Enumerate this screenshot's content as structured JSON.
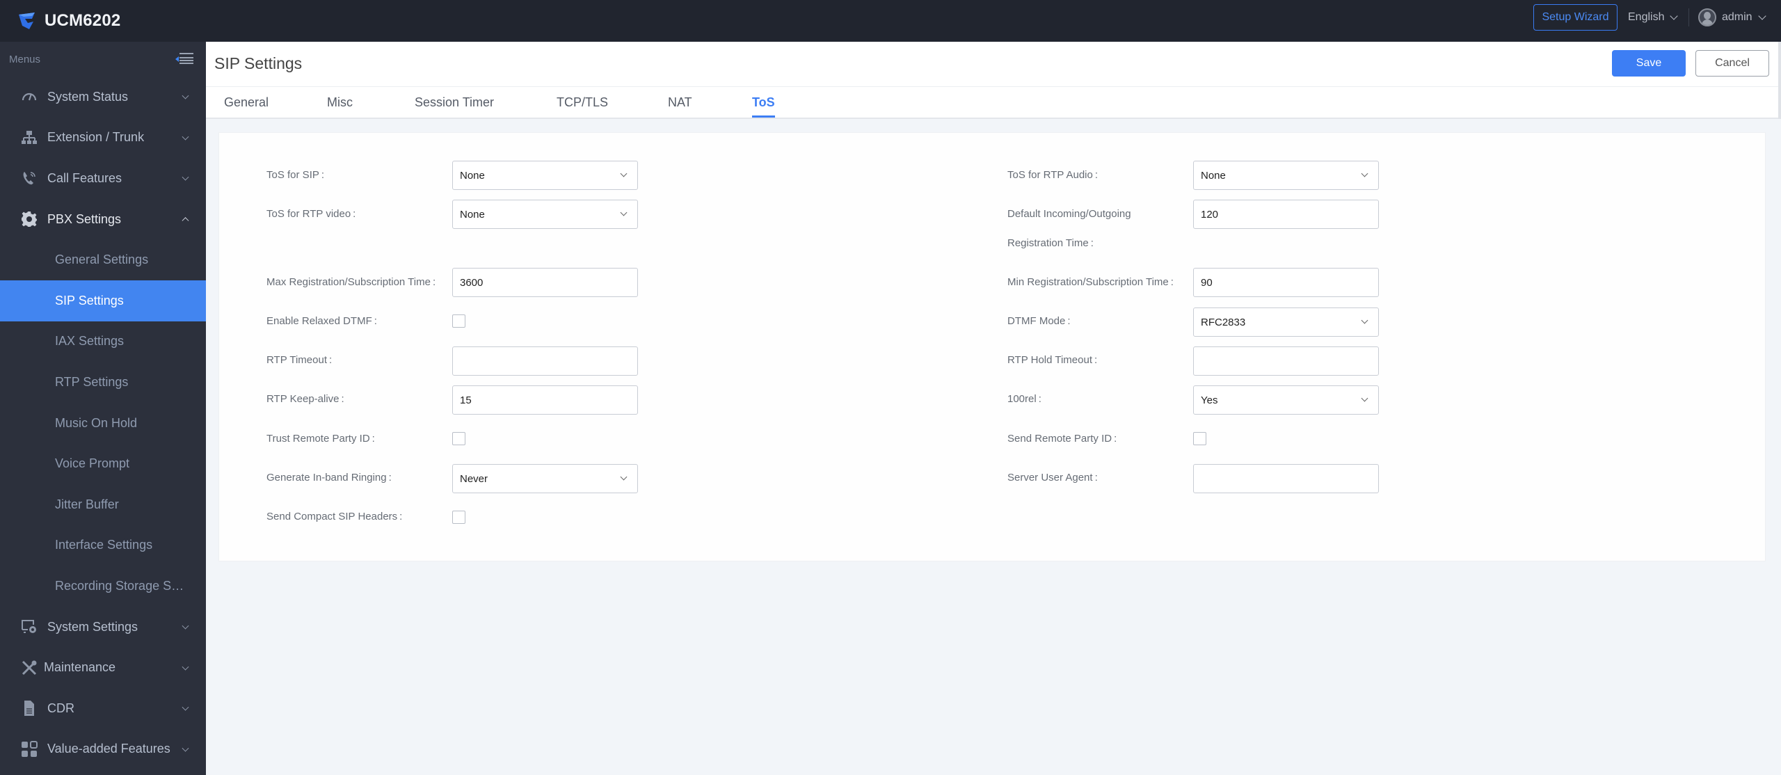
{
  "header": {
    "app_name": "UCM6202",
    "setup_wizard": "Setup Wizard",
    "language": "English",
    "user": "admin"
  },
  "sidebar": {
    "menus_label": "Menus",
    "items": [
      {
        "label": "System Status",
        "icon": "gauge-icon"
      },
      {
        "label": "Extension / Trunk",
        "icon": "network-icon"
      },
      {
        "label": "Call Features",
        "icon": "phone-call-icon"
      },
      {
        "label": "PBX Settings",
        "icon": "gear-icon",
        "expanded": true
      }
    ],
    "sub_items": [
      {
        "label": "General Settings"
      },
      {
        "label": "SIP Settings",
        "active": true
      },
      {
        "label": "IAX Settings"
      },
      {
        "label": "RTP Settings"
      },
      {
        "label": "Music On Hold"
      },
      {
        "label": "Voice Prompt"
      },
      {
        "label": "Jitter Buffer"
      },
      {
        "label": "Interface Settings"
      },
      {
        "label": "Recording Storage Se..."
      }
    ],
    "bottom_items": [
      {
        "label": "System Settings",
        "icon": "monitor-gear-icon"
      },
      {
        "label": "Maintenance",
        "icon": "tools-icon"
      },
      {
        "label": "CDR",
        "icon": "document-icon"
      },
      {
        "label": "Value-added Features",
        "icon": "apps-grid-icon"
      }
    ]
  },
  "page": {
    "title": "SIP Settings",
    "save": "Save",
    "cancel": "Cancel",
    "tabs": [
      "General",
      "Misc",
      "Session Timer",
      "TCP/TLS",
      "NAT",
      "ToS"
    ],
    "active_tab": "ToS"
  },
  "form": {
    "tos_sip": {
      "label": "ToS for SIP",
      "value": "None"
    },
    "tos_rtp_audio": {
      "label": "ToS for RTP Audio",
      "value": "None"
    },
    "tos_rtp_video": {
      "label": "ToS for RTP video",
      "value": "None"
    },
    "default_reg_time": {
      "label_line1": "Default Incoming/Outgoing",
      "label_line2": "Registration Time",
      "value": "120"
    },
    "max_reg_time": {
      "label": "Max Registration/Subscription Time",
      "value": "3600"
    },
    "min_reg_time": {
      "label": "Min Registration/Subscription Time",
      "value": "90"
    },
    "relaxed_dtmf": {
      "label": "Enable Relaxed DTMF",
      "checked": false
    },
    "dtmf_mode": {
      "label": "DTMF Mode",
      "value": "RFC2833"
    },
    "rtp_timeout": {
      "label": "RTP Timeout",
      "value": ""
    },
    "rtp_hold_timeout": {
      "label": "RTP Hold Timeout",
      "value": ""
    },
    "rtp_keepalive": {
      "label": "RTP Keep-alive",
      "value": "15"
    },
    "rel100": {
      "label": "100rel",
      "value": "Yes"
    },
    "trust_rpid": {
      "label": "Trust Remote Party ID",
      "checked": false
    },
    "send_rpid": {
      "label": "Send Remote Party ID",
      "checked": false
    },
    "inband_ringing": {
      "label": "Generate In-band Ringing",
      "value": "Never"
    },
    "server_user_agent": {
      "label": "Server User Agent",
      "value": ""
    },
    "compact_headers": {
      "label": "Send Compact SIP Headers",
      "checked": false
    }
  },
  "colors": {
    "accent": "#3d7ef4",
    "sidebar_bg": "#2c303c",
    "topbar_bg": "#21252f",
    "active_item": "#4285f0"
  }
}
